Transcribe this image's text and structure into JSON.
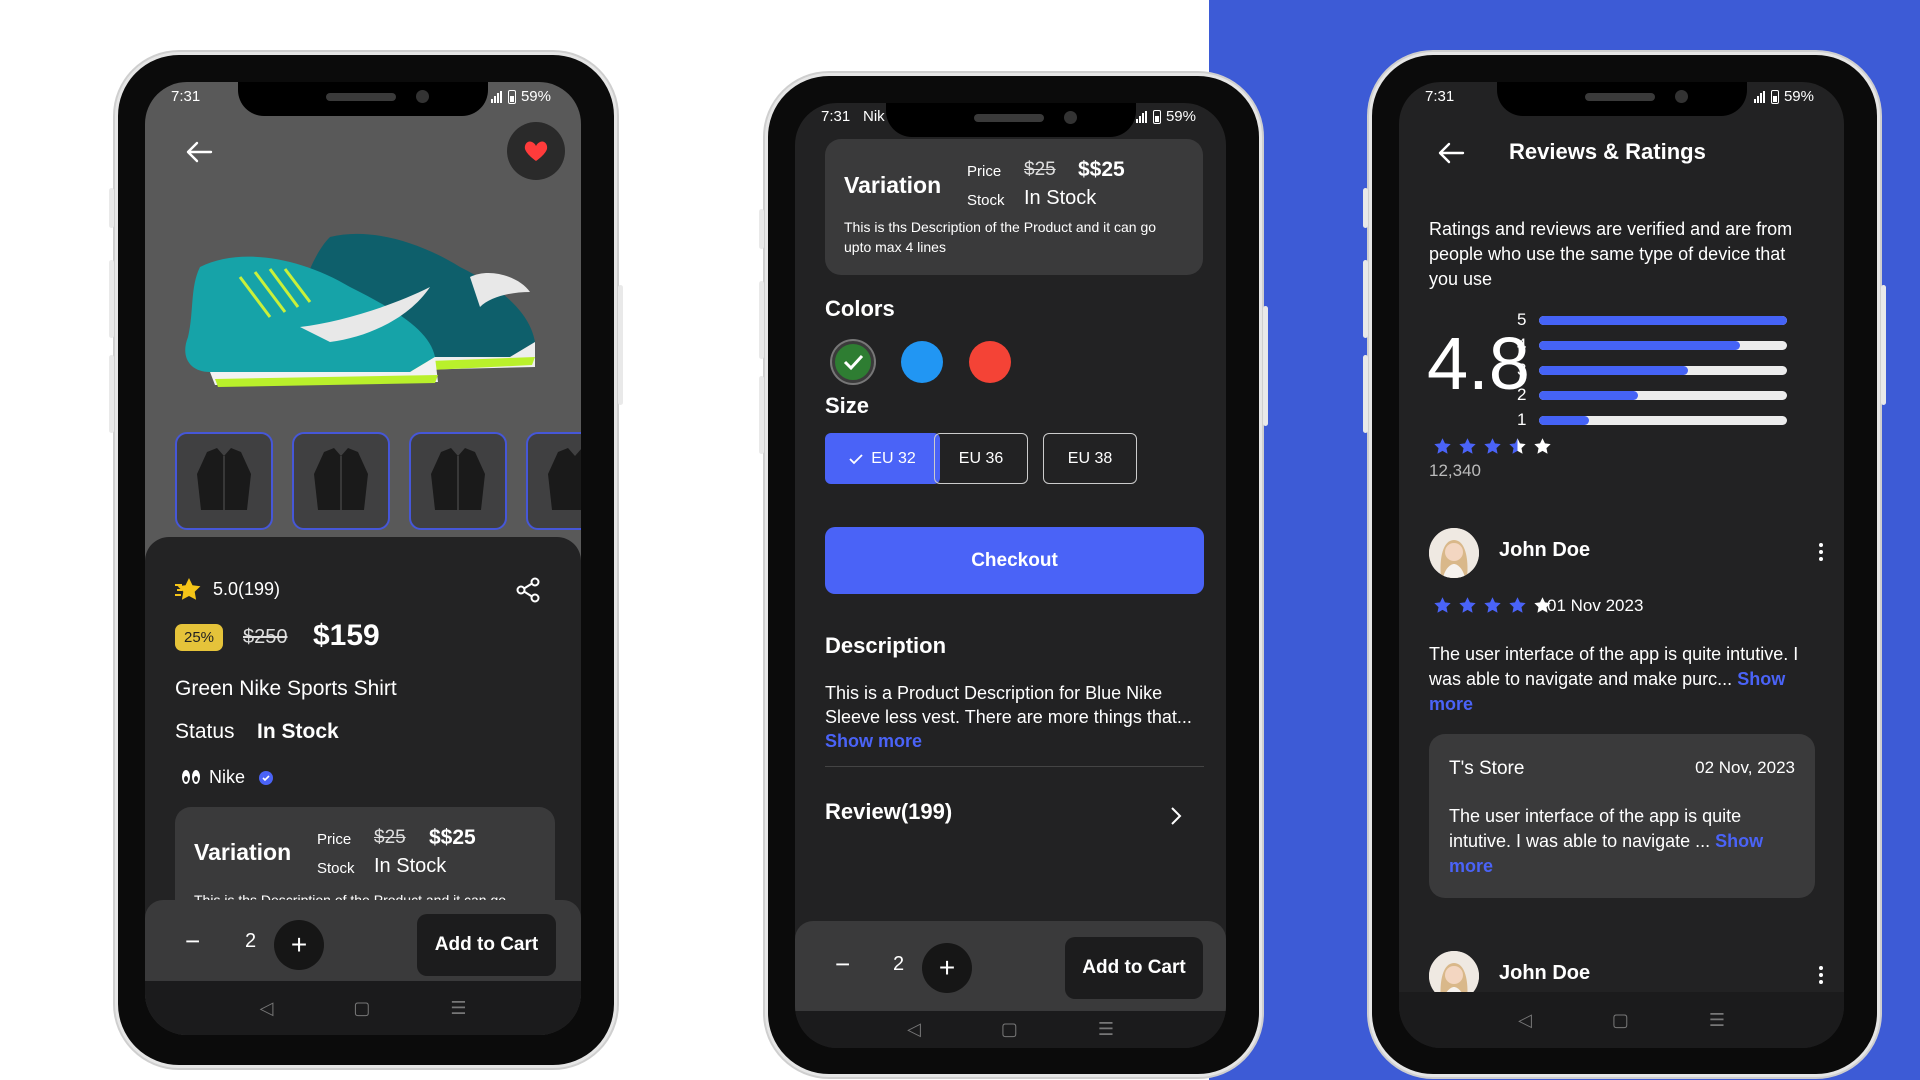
{
  "status": {
    "time": "7:31",
    "battery": "59%",
    "brand_short": "Nik"
  },
  "left": {
    "rating": "5.0(199)",
    "discount_badge": "25%",
    "old_price": "$250",
    "price": "$159",
    "product_name": "Green Nike Sports Shirt",
    "status_label": "Status",
    "status_value": "In Stock",
    "brand": "Nike",
    "quantity": "2",
    "add_to_cart": "Add to Cart"
  },
  "variation": {
    "title": "Variation",
    "price_label": "Price",
    "old_price": "$25",
    "price": "$$25",
    "stock_label": "Stock",
    "stock_value": "In Stock",
    "description": "This is ths Description of the Product and it can go upto max 4 lines"
  },
  "middle": {
    "colors_title": "Colors",
    "colors": [
      "#2e7d32",
      "#2196f3",
      "#f44336"
    ],
    "size_title": "Size",
    "sizes": [
      "EU 32",
      "EU 36",
      "EU 38"
    ],
    "checkout": "Checkout",
    "description_title": "Description",
    "description": "This is a Product Description for Blue Nike Sleeve less vest. There are more things that...",
    "show_more": "Show more",
    "review_title": "Review(199)",
    "quantity": "2",
    "add_to_cart": "Add to Cart"
  },
  "right": {
    "title": "Reviews & Ratings",
    "intro": "Ratings and reviews are verified and are from people who use the same type of device that you use",
    "rating": "4.8",
    "rating_fraction": 0.96,
    "bars": [
      {
        "label": "5",
        "fraction": 1.0
      },
      {
        "label": "4",
        "fraction": 0.81
      },
      {
        "label": "3",
        "fraction": 0.6
      },
      {
        "label": "2",
        "fraction": 0.4
      },
      {
        "label": "1",
        "fraction": 0.2
      }
    ],
    "review_count": "12,340",
    "reviews": [
      {
        "name": "John Doe",
        "date": "01 Nov 2023",
        "stars": 4,
        "text": "The user interface of the app is quite intutive. I was able to navigate and make purc...",
        "show_more": "Show more"
      }
    ],
    "reply": {
      "store": "T's Store",
      "date": "02 Nov, 2023",
      "text": "The user interface of the app is quite intutive. I was able to navigate ...",
      "show_more": "Show more"
    },
    "second_reviewer": "John Doe"
  },
  "accent": "#4a63f7",
  "background_accent": "#3d5bd6"
}
